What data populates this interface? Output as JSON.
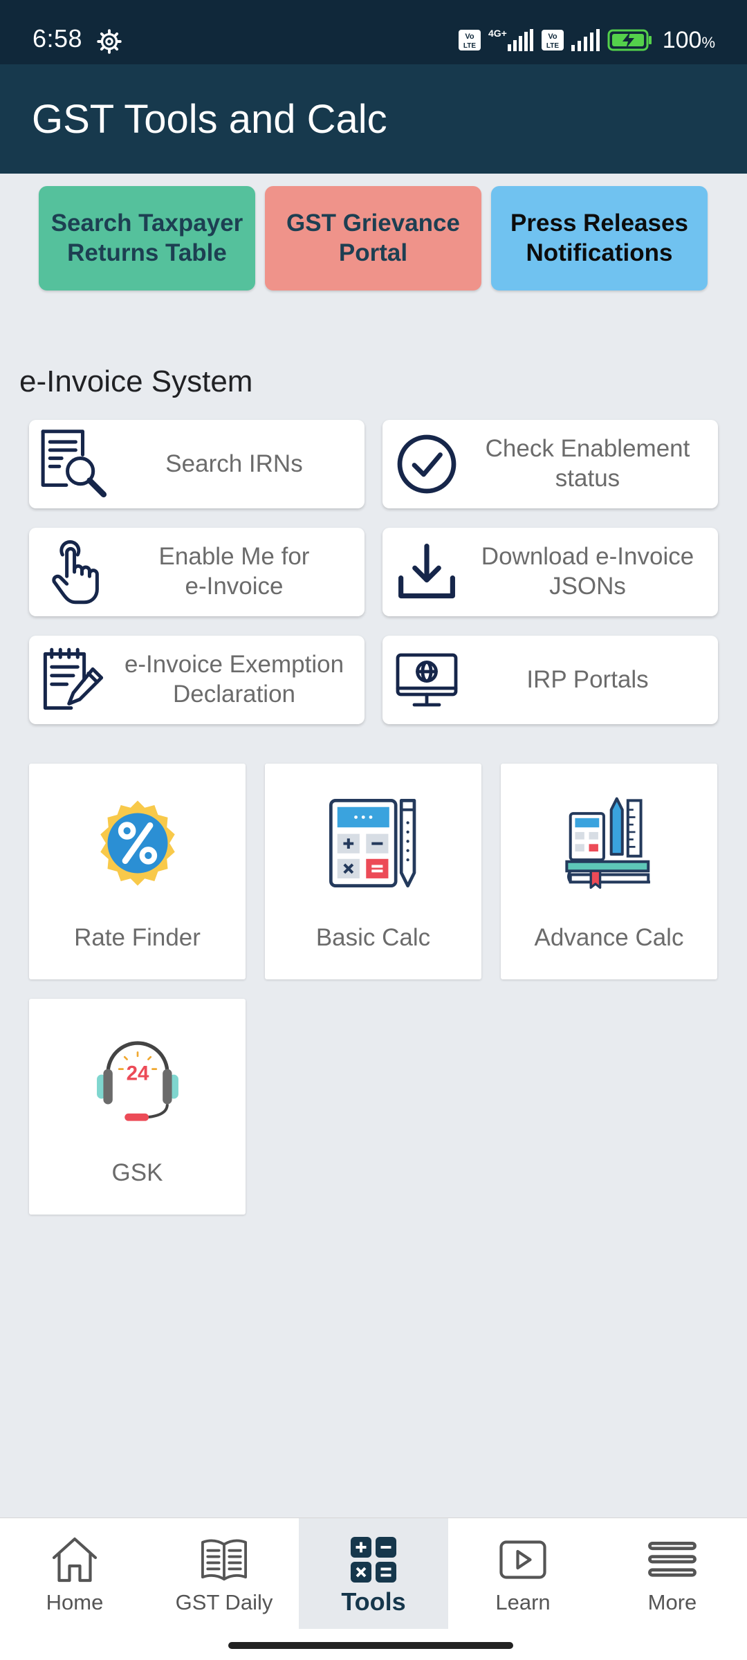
{
  "status_bar": {
    "time": "6:58",
    "battery": "100",
    "battery_unit": "%",
    "network": "4G+"
  },
  "app_bar": {
    "title": "GST Tools and Calc"
  },
  "quick_links": [
    {
      "label_line1": "Search Taxpayer",
      "label_line2": "Returns Table",
      "color": "#55c19c"
    },
    {
      "label_line1": "GST Grievance",
      "label_line2": "Portal",
      "color": "#ef938a"
    },
    {
      "label_line1": "Press Releases",
      "label_line2": "Notifications",
      "color": "#70c2f0"
    }
  ],
  "einvoice": {
    "title": "e-Invoice System",
    "items": [
      {
        "label_line1": "Search IRNs",
        "label_line2": "",
        "icon": "search-document-icon"
      },
      {
        "label_line1": "Check Enablement",
        "label_line2": "status",
        "icon": "check-circle-icon"
      },
      {
        "label_line1": "Enable Me for",
        "label_line2": "e-Invoice",
        "icon": "hand-pointer-icon"
      },
      {
        "label_line1": "Download e-Invoice",
        "label_line2": "JSONs",
        "icon": "download-icon"
      },
      {
        "label_line1": "e-Invoice Exemption",
        "label_line2": "Declaration",
        "icon": "notepad-edit-icon"
      },
      {
        "label_line1": "IRP Portals",
        "label_line2": "",
        "icon": "monitor-globe-icon"
      }
    ]
  },
  "tools": [
    {
      "label": "Rate Finder",
      "icon": "percent-badge-icon"
    },
    {
      "label": "Basic Calc",
      "icon": "calculator-icon"
    },
    {
      "label": "Advance Calc",
      "icon": "calculator-books-icon"
    },
    {
      "label": "GSK",
      "icon": "headset-24-icon",
      "badge": "24"
    }
  ],
  "bottom_nav": {
    "items": [
      {
        "label": "Home",
        "icon": "home-icon"
      },
      {
        "label": "GST Daily",
        "icon": "book-icon"
      },
      {
        "label": "Tools",
        "icon": "tools-calculator-icon",
        "active": true
      },
      {
        "label": "Learn",
        "icon": "play-icon"
      },
      {
        "label": "More",
        "icon": "menu-icon"
      }
    ]
  },
  "colors": {
    "status_bar": "#10283a",
    "app_bar": "#17394d",
    "background": "#e8ebef",
    "icon_navy": "#16264a"
  }
}
